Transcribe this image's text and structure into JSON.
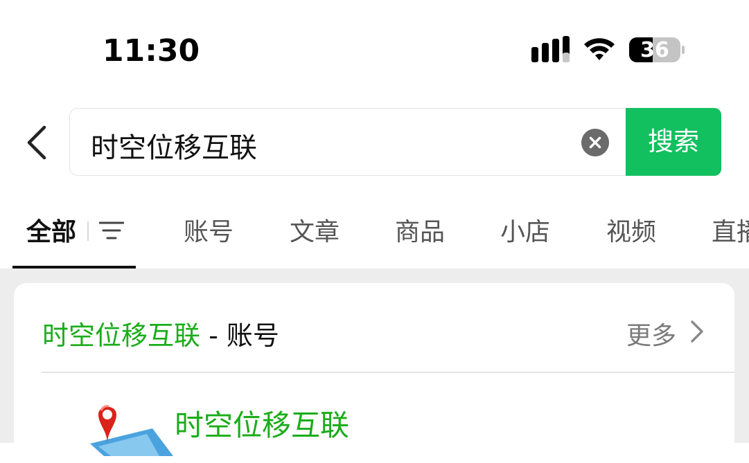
{
  "status_bar": {
    "time": "11:30",
    "battery": "36",
    "signal_icon": "cellular-signal-icon",
    "wifi_icon": "wifi-icon"
  },
  "search": {
    "back_icon": "chevron-left-icon",
    "query": "时空位移互联",
    "clear_icon": "clear-circle-icon",
    "button_label": "搜索",
    "accent_color": "#12c060"
  },
  "tabs": {
    "items": [
      {
        "label": "全部",
        "active": true
      },
      {
        "label": "账号"
      },
      {
        "label": "文章"
      },
      {
        "label": "商品"
      },
      {
        "label": "小店"
      },
      {
        "label": "视频"
      },
      {
        "label": "直播"
      }
    ],
    "filter_icon": "filter-icon"
  },
  "section": {
    "title_highlight": "时空位移互联",
    "title_suffix": " - 账号",
    "more_label": "更多",
    "more_icon": "chevron-right-icon",
    "highlight_color": "#1aad19"
  },
  "result": {
    "name": "时空位移互联",
    "logo_icon": "location-pin-map-logo"
  }
}
